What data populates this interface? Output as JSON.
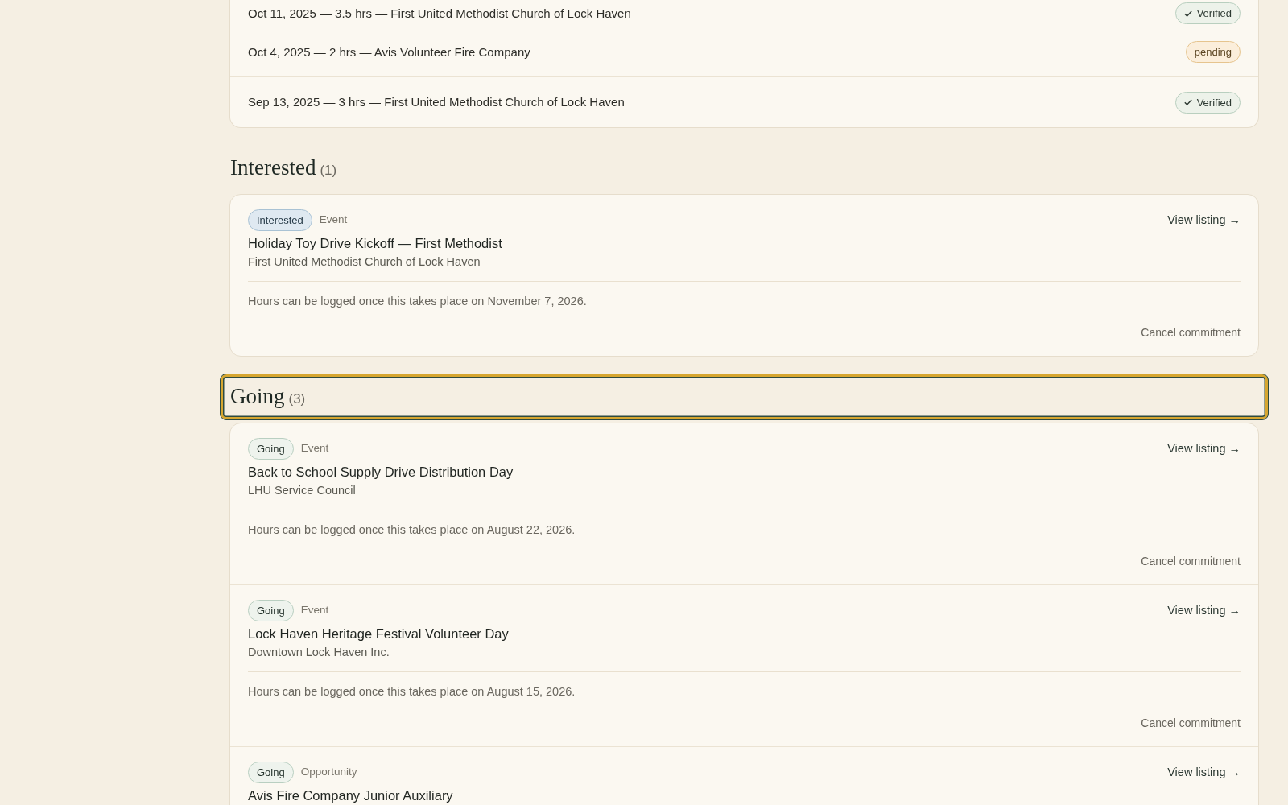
{
  "hours_log": {
    "entries": [
      {
        "text": "Oct 11, 2025 — 3.5 hrs — First United Methodist Church of Lock Haven",
        "kind": "verified",
        "badge": "Verified"
      },
      {
        "text": "Oct 4, 2025 — 2 hrs — Avis Volunteer Fire Company",
        "kind": "pending",
        "badge": "pending"
      },
      {
        "text": "Sep 13, 2025 — 3 hrs — First United Methodist Church of Lock Haven",
        "kind": "verified",
        "badge": "Verified"
      }
    ]
  },
  "sections": [
    {
      "heading": "Interested",
      "count": "(1)",
      "focused": false,
      "items": [
        {
          "kind": "interested",
          "badge": "Interested",
          "type": "Event",
          "title": "Holiday Toy Drive Kickoff — First Methodist",
          "organization": "First United Methodist Church of Lock Haven",
          "note": "Hours can be logged once this takes place on November 7, 2026.",
          "link": "View listing →",
          "action": "Cancel commitment"
        }
      ]
    },
    {
      "heading": "Going",
      "count": "(3)",
      "focused": true,
      "items": [
        {
          "kind": "going",
          "badge": "Going",
          "type": "Event",
          "title": "Back to School Supply Drive Distribution Day",
          "organization": "LHU Service Council",
          "note": "Hours can be logged once this takes place on August 22, 2026.",
          "link": "View listing →",
          "action": "Cancel commitment"
        },
        {
          "kind": "going",
          "badge": "Going",
          "type": "Event",
          "title": "Lock Haven Heritage Festival Volunteer Day",
          "organization": "Downtown Lock Haven Inc.",
          "note": "Hours can be logged once this takes place on August 15, 2026.",
          "link": "View listing →",
          "action": "Cancel commitment"
        },
        {
          "kind": "going",
          "badge": "Going",
          "type": "Opportunity",
          "title": "Avis Fire Company Junior Auxiliary",
          "link": "View listing →"
        }
      ]
    }
  ]
}
